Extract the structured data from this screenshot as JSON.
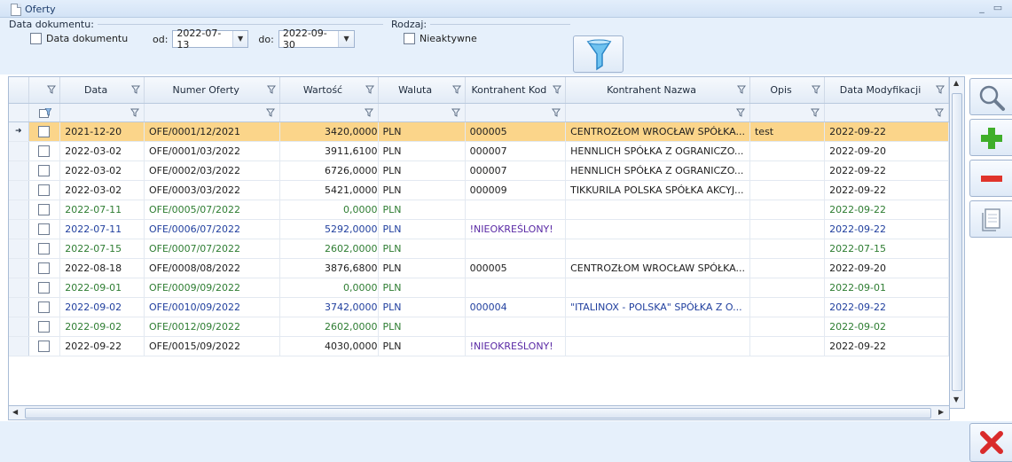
{
  "window": {
    "title": "Oferty",
    "minimize": "_",
    "maximize": "▭"
  },
  "filters": {
    "date_group_label": "Data dokumentu:",
    "date_checkbox_label": "Data dokumentu",
    "from_label": "od:",
    "from_value": "2022-07-13",
    "to_label": "do:",
    "to_value": "2022-09-30",
    "type_group_label": "Rodzaj:",
    "inactive_label": "Nieaktywne"
  },
  "grid": {
    "columns": [
      "",
      "Data",
      "Numer Oferty",
      "Wartość",
      "Waluta",
      "Kontrahent Kod",
      "Kontrahent Nazwa",
      "Opis",
      "Data Modyfikacji"
    ],
    "rows": [
      {
        "date": "2021-12-20",
        "number": "OFE/0001/12/2021",
        "value": "3420,0000",
        "currency": "PLN",
        "code": "000005",
        "name": "CENTROZŁOM WROCŁAW SPÓŁKA...",
        "desc": "test",
        "modified": "2022-09-22",
        "style": "",
        "selected": true
      },
      {
        "date": "2022-03-02",
        "number": "OFE/0001/03/2022",
        "value": "3911,6100",
        "currency": "PLN",
        "code": "000007",
        "name": "HENNLICH SPÓŁKA Z OGRANICZO...",
        "desc": "",
        "modified": "2022-09-20",
        "style": "",
        "selected": false
      },
      {
        "date": "2022-03-02",
        "number": "OFE/0002/03/2022",
        "value": "6726,0000",
        "currency": "PLN",
        "code": "000007",
        "name": "HENNLICH SPÓŁKA Z OGRANICZO...",
        "desc": "",
        "modified": "2022-09-22",
        "style": "",
        "selected": false
      },
      {
        "date": "2022-03-02",
        "number": "OFE/0003/03/2022",
        "value": "5421,0000",
        "currency": "PLN",
        "code": "000009",
        "name": "TIKKURILA POLSKA SPÓŁKA AKCYJ...",
        "desc": "",
        "modified": "2022-09-22",
        "style": "",
        "selected": false
      },
      {
        "date": "2022-07-11",
        "number": "OFE/0005/07/2022",
        "value": "0,0000",
        "currency": "PLN",
        "code": "",
        "name": "",
        "desc": "",
        "modified": "2022-09-22",
        "style": "green",
        "selected": false
      },
      {
        "date": "2022-07-11",
        "number": "OFE/0006/07/2022",
        "value": "5292,0000",
        "currency": "PLN",
        "code": "!NIEOKREŚLONY!",
        "name": "",
        "desc": "",
        "modified": "2022-09-22",
        "style": "blue",
        "selected": false
      },
      {
        "date": "2022-07-15",
        "number": "OFE/0007/07/2022",
        "value": "2602,0000",
        "currency": "PLN",
        "code": "",
        "name": "",
        "desc": "",
        "modified": "2022-07-15",
        "style": "green",
        "selected": false
      },
      {
        "date": "2022-08-18",
        "number": "OFE/0008/08/2022",
        "value": "3876,6800",
        "currency": "PLN",
        "code": "000005",
        "name": "CENTROZŁOM WROCŁAW SPÓŁKA...",
        "desc": "",
        "modified": "2022-09-20",
        "style": "",
        "selected": false
      },
      {
        "date": "2022-09-01",
        "number": "OFE/0009/09/2022",
        "value": "0,0000",
        "currency": "PLN",
        "code": "",
        "name": "",
        "desc": "",
        "modified": "2022-09-01",
        "style": "green",
        "selected": false
      },
      {
        "date": "2022-09-02",
        "number": "OFE/0010/09/2022",
        "value": "3742,0000",
        "currency": "PLN",
        "code": "000004",
        "name": "\"ITALINOX - POLSKA\" SPÓŁKA Z O...",
        "desc": "",
        "modified": "2022-09-22",
        "style": "blue",
        "selected": false
      },
      {
        "date": "2022-09-02",
        "number": "OFE/0012/09/2022",
        "value": "2602,0000",
        "currency": "PLN",
        "code": "",
        "name": "",
        "desc": "",
        "modified": "2022-09-02",
        "style": "green",
        "selected": false
      },
      {
        "date": "2022-09-22",
        "number": "OFE/0015/09/2022",
        "value": "4030,0000",
        "currency": "PLN",
        "code": "!NIEOKREŚLONY!",
        "name": "",
        "desc": "",
        "modified": "2022-09-22",
        "style": "",
        "selected": false
      }
    ]
  },
  "toolbar": {
    "icons": [
      "search-icon",
      "add-icon",
      "remove-icon",
      "copy-document-icon",
      "close-icon"
    ]
  },
  "colors": {
    "selection": "#fbd58a",
    "green_row": "#2e7d32",
    "blue_row": "#203f9e",
    "unspecified_code": "#5a2aa5",
    "add": "#3fae2a",
    "remove": "#e0342b",
    "close": "#d92b2b"
  }
}
